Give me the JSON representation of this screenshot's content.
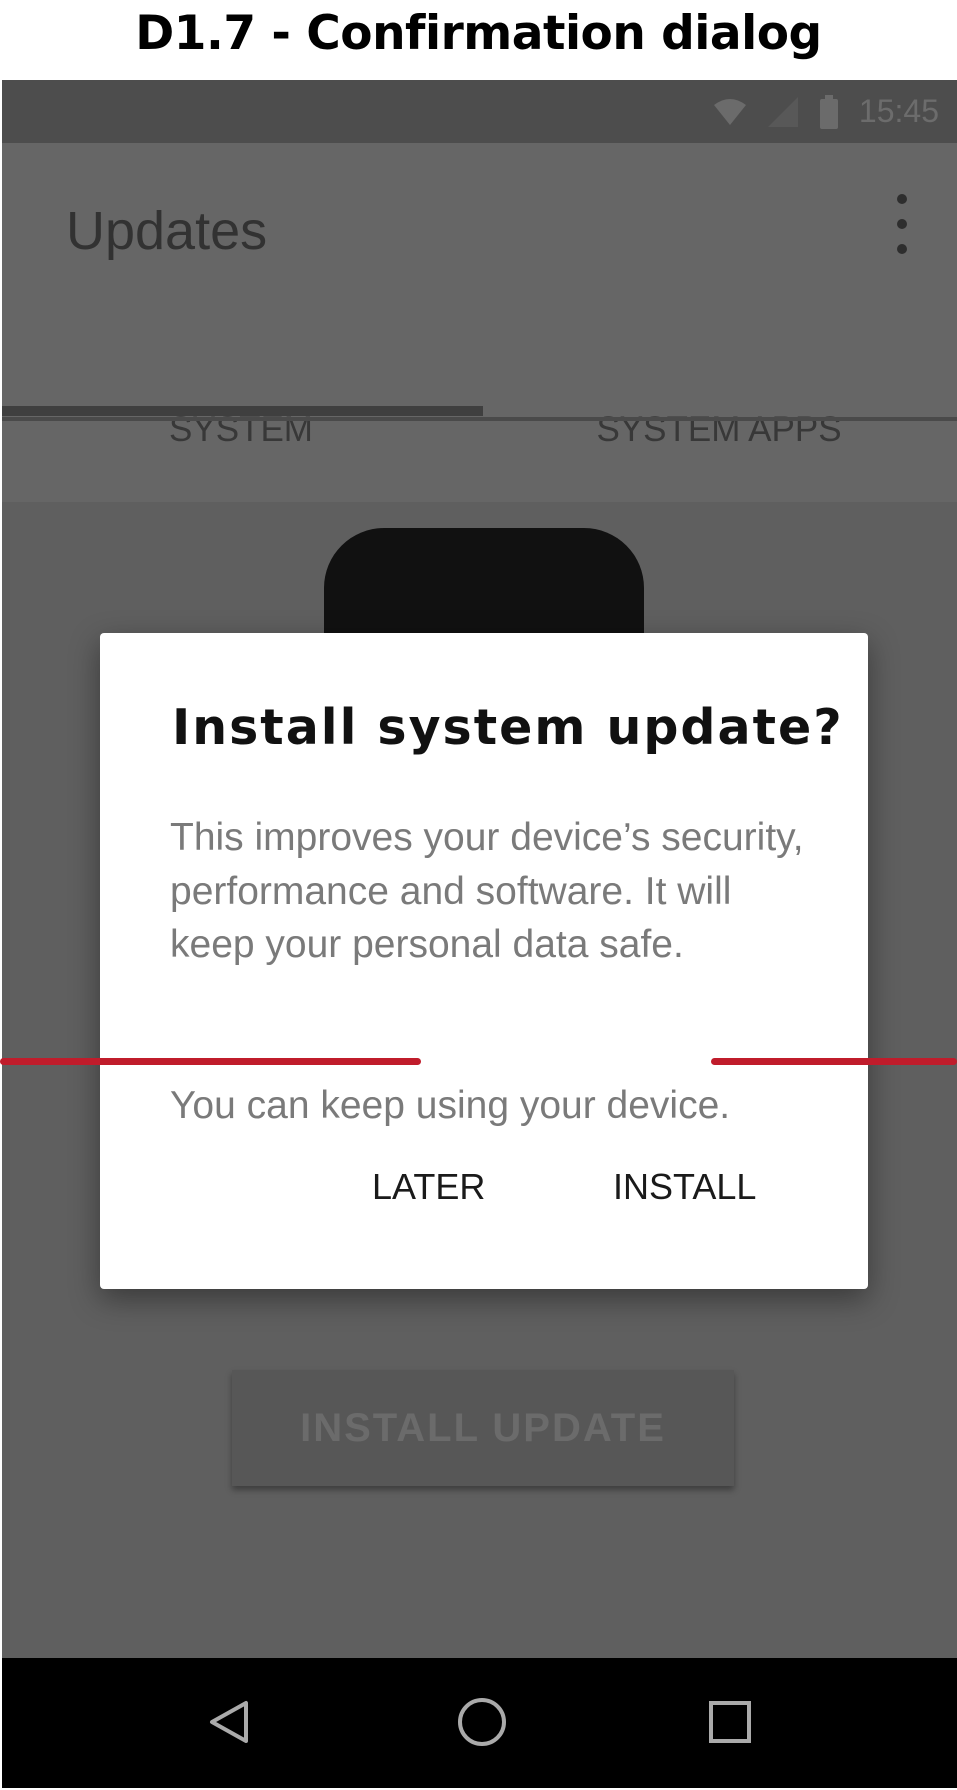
{
  "caption": "D1.7 - Confirmation dialog",
  "status_bar": {
    "time": "15:45",
    "icons": [
      "wifi-icon",
      "signal-icon",
      "battery-icon"
    ]
  },
  "app_bar": {
    "title": "Updates",
    "menu_icon": "overflow-menu-icon"
  },
  "tabs": [
    {
      "label": "SYSTEM",
      "selected": true
    },
    {
      "label": "SYSTEM APPS",
      "selected": false
    }
  ],
  "background_button": {
    "label": "INSTALL UPDATE"
  },
  "dialog": {
    "title": "Install system update?",
    "body": "This improves your device’s security, performance and software. It will keep your personal data safe.",
    "body_secondary": "You can keep using your device.",
    "buttons": {
      "later": "LATER",
      "install": "INSTALL"
    }
  },
  "nav_bar": {
    "icons": [
      "back-icon",
      "home-icon",
      "recents-icon"
    ]
  },
  "colors": {
    "scrim": "#5f5f5f",
    "dialog_bg": "#ffffff",
    "annotation": "#c01c2b",
    "nav_bar": "#000000"
  }
}
